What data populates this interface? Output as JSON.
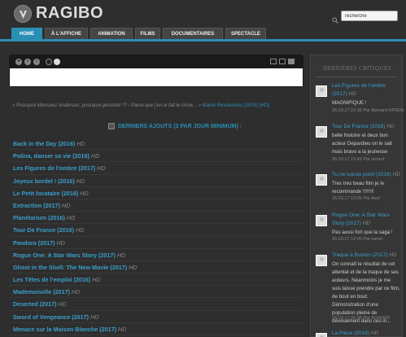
{
  "brand": {
    "name": "RAGIBO",
    "tagline": ""
  },
  "search": {
    "value": "recherche"
  },
  "nav": [
    "HOME",
    "À L'AFFICHE",
    "ANIMATION",
    "FILMS",
    "DOCUMENTAIRES",
    "SPECTACLE"
  ],
  "quote": {
    "text": "« Pourquoi Monsieur Anderson, pourquoi persister !? - Parce que j'en ai fait le choix... » ",
    "link": "Matrix Revolutions (2003) [HD]"
  },
  "latest": {
    "heading": "DERNIERS AJOUTS (3 PAR JOUR MINIMUM) :",
    "items": [
      {
        "title": "Back in the Day (2016)",
        "tag": "HD"
      },
      {
        "title": "Polina, danser sa vie (2016)",
        "tag": "HD"
      },
      {
        "title": "Les Figures de l'ombre (2017)",
        "tag": "HD"
      },
      {
        "title": "Joyeux bordel ! (2016)",
        "tag": "HD"
      },
      {
        "title": "Le Petit locataire (2016)",
        "tag": "HD"
      },
      {
        "title": "Extraction (2017)",
        "tag": "HD"
      },
      {
        "title": "Planétarium (2016)",
        "tag": "HD"
      },
      {
        "title": "Tour De France (2016)",
        "tag": "HD"
      },
      {
        "title": "Pandora (2017)",
        "tag": "HD"
      },
      {
        "title": "Rogue One: A Star Wars Story (2017)",
        "tag": "HD"
      },
      {
        "title": "Ghost in the Shell: The New Movie (2017)",
        "tag": "HD"
      },
      {
        "title": "Les Têtes de l'emploi (2016)",
        "tag": "HD"
      },
      {
        "title": "Mademoiselle (2017)",
        "tag": "HD"
      },
      {
        "title": "Deserted (2017)",
        "tag": "HD"
      },
      {
        "title": "Sword of Vengeance (2017)",
        "tag": "HD"
      },
      {
        "title": "Menace sur la Maison Blanche (2017)",
        "tag": "HD"
      }
    ]
  },
  "sidebar": {
    "title": "DERNIÈRES CRITIQUES",
    "reviews": [
      {
        "title": "Les Figures de l'ombre (2017)",
        "tag": "HD",
        "text": "MAGNIFIQUE !",
        "meta": "26.03.17 16:32 Par Bernard FATERL"
      },
      {
        "title": "Tour De France (2016)",
        "tag": "HD",
        "text": "belle histoire et deux bon acteur Depardieu on le sait mais bravo a la jeunesse",
        "meta": "26.03.17 15:43 Par renard"
      },
      {
        "title": "Tu ne tueras point (2016)",
        "tag": "HD",
        "text": "Tres tres beau film je le recommande !!!!!!!!",
        "meta": "26.03.17 13:06 Par Axel"
      },
      {
        "title": "Rogue One: A Star Wars Story (2017)",
        "tag": "HD",
        "text": "Pas aussi fort que la saga !",
        "meta": "26.03.17 12:00 Par hamri"
      },
      {
        "title": "Traque à Boston (2017)",
        "tag": "HD",
        "text": "On connaît le résultat de cet attentat et de la traque de ses auteurs. Néanmoins je me suis laissé prendre par ce film, de bout en bout. Démonstration d'une population pleine de dévouement dans ces in...",
        "meta": "26.03.17 06:48 Par KORDEK"
      },
      {
        "title": "La Pièce (2016)",
        "tag": "HD",
        "text": "",
        "meta": ""
      }
    ]
  },
  "colors": {
    "accent": "#2a8fb5",
    "link": "#3a9fcc",
    "background": "#2e2e2e"
  }
}
